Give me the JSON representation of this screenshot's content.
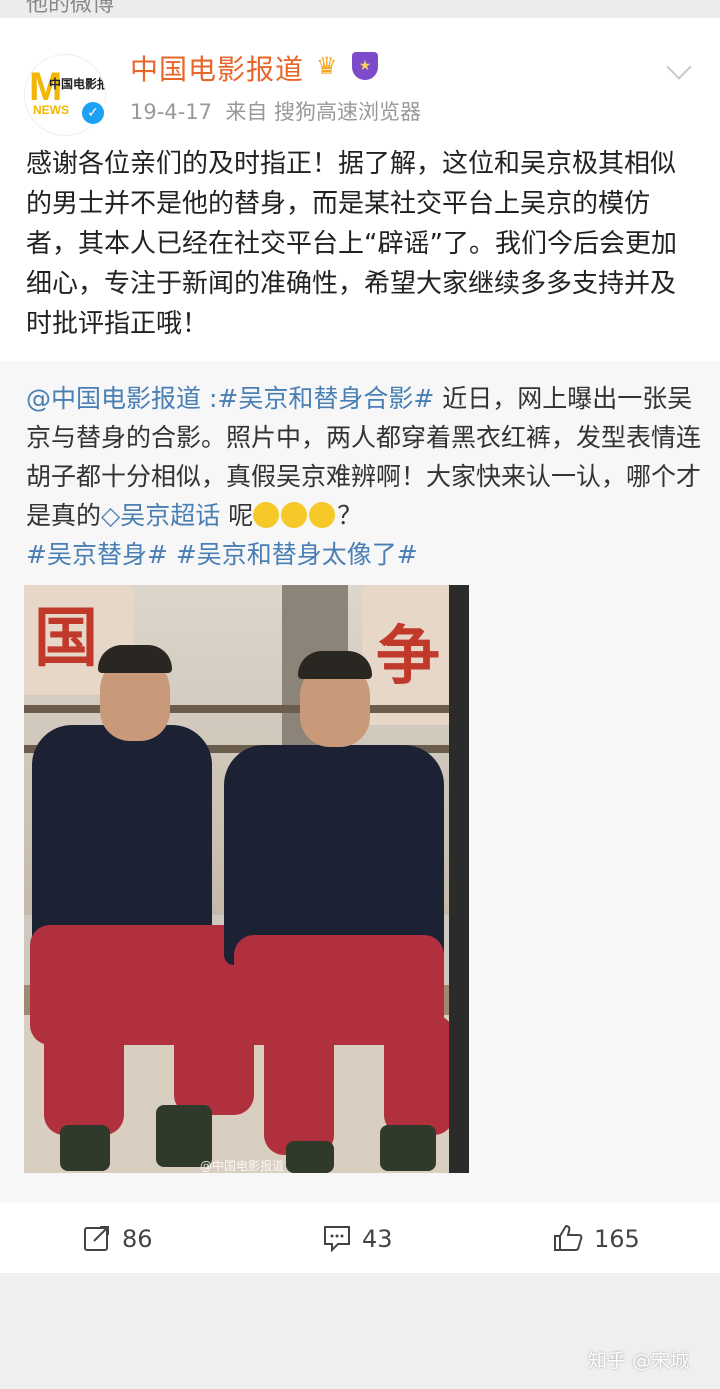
{
  "header_strip": {
    "text": "他的微博"
  },
  "post": {
    "author": "中国电影报道",
    "avatar_text": {
      "m": "M",
      "news": "NEWS",
      "cn": "中国电影报道"
    },
    "verified_icon": "verified-check-icon",
    "badges": [
      "crown-icon",
      "shield-icon"
    ],
    "date": "19-4-17",
    "source_prefix": "来自",
    "source": "搜狗高速浏览器",
    "text": "感谢各位亲们的及时指正！据了解，这位和吴京极其相似的男士并不是他的替身，而是某社交平台上吴京的模仿者，其本人已经在社交平台上“辟谣”了。我们今后会更加细心，专注于新闻的准确性，希望大家继续多多支持并及时批评指正哦！"
  },
  "retweet": {
    "mention": "@中国电影报道",
    "sep": " :",
    "tag1": "#吴京和替身合影#",
    "text1": " 近日，网上曝出一张吴京与替身的合影。照片中，两人都穿着黑衣红裤，发型表情连胡子都十分相似，真假吴京难辨啊！大家快来认一认，哪个才是真的",
    "superchat": "吴京超话",
    "text2": " 呢",
    "emoji_count": 3,
    "qmark": "？",
    "tag2": "#吴京替身#",
    "tag3": "#吴京和替身太像了#",
    "photo": {
      "banner_left": "国",
      "banner_right": "争",
      "watermark": "@中国电影报道"
    }
  },
  "actions": {
    "repost": "86",
    "comment": "43",
    "like": "165"
  },
  "footer_watermark": "知乎 @宋城",
  "colors": {
    "name": "#e8662a",
    "link": "#4a7fb4",
    "meta": "#999999"
  }
}
